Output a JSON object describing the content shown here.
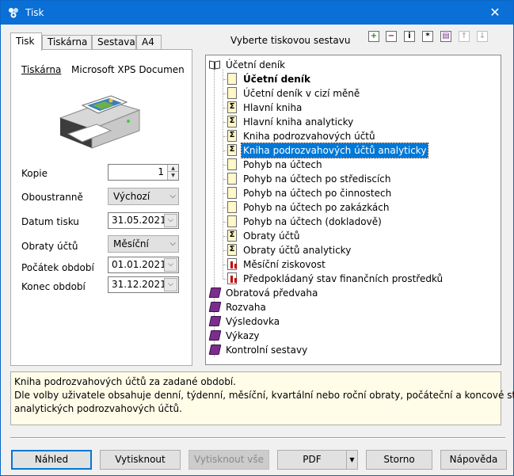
{
  "window": {
    "title": "Tisk",
    "close_glyph": "✕"
  },
  "tabs": [
    {
      "label": "Tisk"
    },
    {
      "label": "Tiskárna"
    },
    {
      "label": "Sestava"
    },
    {
      "label": "A4"
    }
  ],
  "printer": {
    "label": "Tiskárna",
    "name": "Microsoft XPS Document W"
  },
  "form": {
    "kopie": {
      "label": "Kopie",
      "value": "1"
    },
    "oboustranne": {
      "label": "Oboustranně",
      "value": "Výchozí"
    },
    "datum_tisku": {
      "label": "Datum tisku",
      "value": "31.05.2021"
    },
    "obraty_uctu": {
      "label": "Obraty účtů",
      "value": "Měsíční"
    },
    "pocatek": {
      "label": "Počátek období",
      "value": "01.01.2021"
    },
    "konec": {
      "label": "Konec období",
      "value": "31.12.2021"
    }
  },
  "select_label": "Vyberte tiskovou sestavu",
  "toolbar_icons": [
    "add-icon",
    "remove-icon",
    "info-icon",
    "properties-icon",
    "copy-icon",
    "move-up-icon",
    "move-down-icon"
  ],
  "tree": {
    "root": "Účetní deník",
    "children": [
      {
        "label": "Účetní deník",
        "icon": "page-icon"
      },
      {
        "label": "Účetní deník v cizí měně",
        "icon": "page-icon"
      },
      {
        "label": "Hlavní kniha",
        "icon": "sigma-icon"
      },
      {
        "label": "Hlavní kniha analyticky",
        "icon": "sigma-icon"
      },
      {
        "label": "Kniha podrozvahových účtů",
        "icon": "sigma-icon"
      },
      {
        "label": "Kniha podrozvahových účtů analyticky",
        "icon": "sigma-icon"
      },
      {
        "label": "Pohyb na účtech",
        "icon": "page-icon"
      },
      {
        "label": "Pohyb na účtech po střediscích",
        "icon": "page-icon"
      },
      {
        "label": "Pohyb na účtech po činnostech",
        "icon": "page-icon"
      },
      {
        "label": "Pohyb na účtech po zakázkách",
        "icon": "page-icon"
      },
      {
        "label": "Pohyb na účtech (dokladově)",
        "icon": "page-icon"
      },
      {
        "label": "Obraty účtů",
        "icon": "sigma-icon"
      },
      {
        "label": "Obraty účtů analyticky",
        "icon": "sigma-icon"
      },
      {
        "label": "Měsíční ziskovost",
        "icon": "chart-icon"
      },
      {
        "label": "Předpokládaný stav finančních prostředků",
        "icon": "chart-icon"
      }
    ],
    "groups": [
      {
        "label": "Obratová předvaha"
      },
      {
        "label": "Rozvaha"
      },
      {
        "label": "Výsledovka"
      },
      {
        "label": "Výkazy"
      },
      {
        "label": "Kontrolní sestavy"
      }
    ]
  },
  "description": {
    "line1": "Kniha podrozvahových účtů za zadané období.",
    "line2": "Dle volby uživatele obsahuje denní, týdenní, měsíční, kvartální nebo roční obraty, počáteční a koncové stavy",
    "line3": "analytických podrozvahových účtů."
  },
  "buttons": {
    "nahled": "Náhled",
    "vytisknout": "Vytisknout",
    "vytisknout_vse": "Vytisknout vše",
    "pdf": "PDF",
    "storno": "Storno",
    "napoveda": "Nápověda"
  }
}
